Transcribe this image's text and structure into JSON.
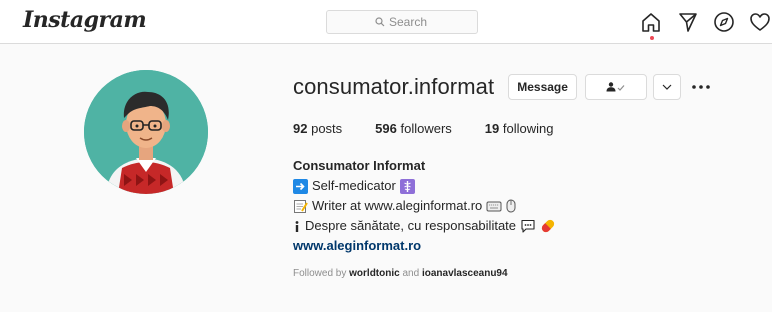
{
  "header": {
    "logo": "Instagram",
    "search_placeholder": "Search"
  },
  "profile": {
    "username": "consumator.informat",
    "message_button": "Message",
    "stats": {
      "posts_count": "92",
      "posts_label": "posts",
      "followers_count": "596",
      "followers_label": "followers",
      "following_count": "19",
      "following_label": "following"
    },
    "bio": {
      "name": "Consumator Informat",
      "line1": "Self-medicator",
      "line2": "Writer at www.aleginformat.ro",
      "line3": "Despre sănătate, cu responsabilitate",
      "website": "www.aleginformat.ro"
    },
    "followed_by": {
      "prefix": "Followed by",
      "user1": "worldtonic",
      "conj": "and",
      "user2": "ioanavlasceanu94"
    }
  },
  "colors": {
    "link": "#00376b",
    "notification_dot": "#ed4956",
    "avatar_bg": "#4fb3a4"
  }
}
